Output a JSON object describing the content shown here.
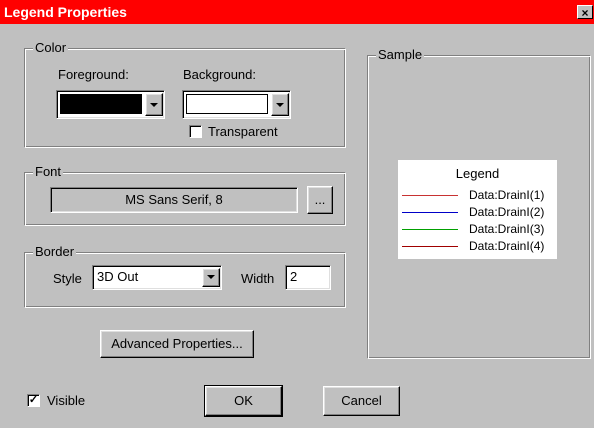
{
  "dialog": {
    "title": "Legend Properties",
    "close_glyph": "×",
    "title_bar_color": "#ff0000"
  },
  "color_group": {
    "label": "Color",
    "foreground_label": "Foreground:",
    "background_label": "Background:",
    "foreground_value": "#000000",
    "background_value": "#ffffff",
    "transparent_label": "Transparent",
    "transparent_checked": false
  },
  "font_group": {
    "label": "Font",
    "value": "MS Sans Serif, 8",
    "browse_label": "..."
  },
  "border_group": {
    "label": "Border",
    "style_label": "Style",
    "style_value": "3D Out",
    "width_label": "Width",
    "width_value": "2"
  },
  "advanced_button": "Advanced Properties...",
  "sample": {
    "label": "Sample",
    "legend_title": "Legend",
    "series": [
      {
        "name": "Data:DrainI(1)",
        "color": "#c83232"
      },
      {
        "name": "Data:DrainI(2)",
        "color": "#0000c8"
      },
      {
        "name": "Data:DrainI(3)",
        "color": "#00a000"
      },
      {
        "name": "Data:DrainI(4)",
        "color": "#a00000"
      }
    ]
  },
  "visible": {
    "label": "Visible",
    "checked": true,
    "check_glyph": "✓"
  },
  "buttons": {
    "ok": "OK",
    "cancel": "Cancel"
  },
  "icons": [
    "close-icon",
    "dropdown-arrow-icon",
    "checkbox-icon"
  ]
}
